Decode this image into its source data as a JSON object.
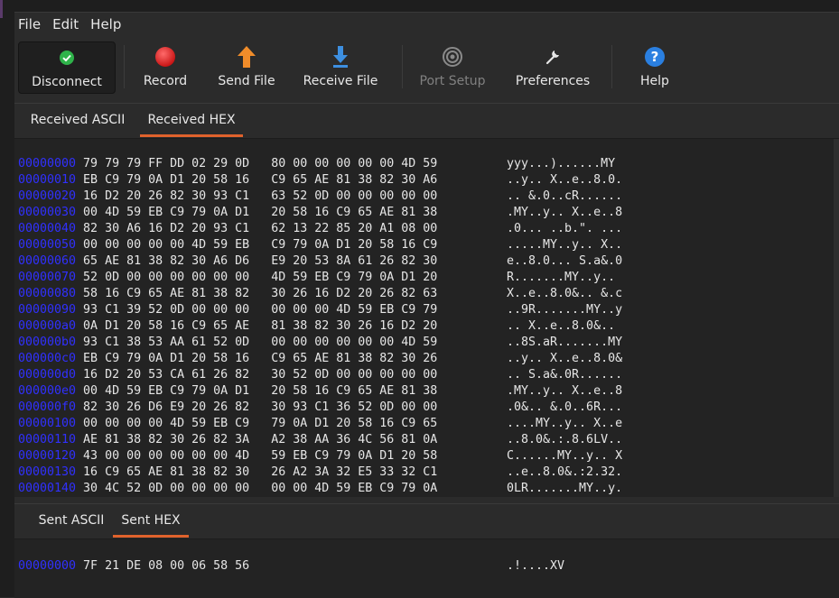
{
  "menu": [
    "File",
    "Edit",
    "Help"
  ],
  "toolbar": {
    "disconnect": "Disconnect",
    "record": "Record",
    "send_file": "Send File",
    "receive_file": "Receive File",
    "port_setup": "Port Setup",
    "preferences": "Preferences",
    "help": "Help"
  },
  "received": {
    "tabs": [
      "Received ASCII",
      "Received HEX"
    ],
    "selected_tab": "Received HEX",
    "rows": [
      {
        "offset": "00000000",
        "hex": "79 79 79 FF DD 02 29 0D   80 00 00 00 00 00 4D 59",
        "ascii": "yyy...)......MY"
      },
      {
        "offset": "00000010",
        "hex": "EB C9 79 0A D1 20 58 16   C9 65 AE 81 38 82 30 A6",
        "ascii": "..y.. X..e..8.0."
      },
      {
        "offset": "00000020",
        "hex": "16 D2 20 26 82 30 93 C1   63 52 0D 00 00 00 00 00",
        "ascii": ".. &.0..cR......"
      },
      {
        "offset": "00000030",
        "hex": "00 4D 59 EB C9 79 0A D1   20 58 16 C9 65 AE 81 38",
        "ascii": ".MY..y.. X..e..8"
      },
      {
        "offset": "00000040",
        "hex": "82 30 A6 16 D2 20 93 C1   62 13 22 85 20 A1 08 00",
        "ascii": ".0... ..b.\". ..."
      },
      {
        "offset": "00000050",
        "hex": "00 00 00 00 00 4D 59 EB   C9 79 0A D1 20 58 16 C9",
        "ascii": ".....MY..y.. X.."
      },
      {
        "offset": "00000060",
        "hex": "65 AE 81 38 82 30 A6 D6   E9 20 53 8A 61 26 82 30",
        "ascii": "e..8.0... S.a&.0"
      },
      {
        "offset": "00000070",
        "hex": "52 0D 00 00 00 00 00 00   4D 59 EB C9 79 0A D1 20",
        "ascii": "R.......MY..y.. "
      },
      {
        "offset": "00000080",
        "hex": "58 16 C9 65 AE 81 38 82   30 26 16 D2 20 26 82 63",
        "ascii": "X..e..8.0&.. &.c"
      },
      {
        "offset": "00000090",
        "hex": "93 C1 39 52 0D 00 00 00   00 00 00 4D 59 EB C9 79",
        "ascii": "..9R.......MY..y"
      },
      {
        "offset": "000000a0",
        "hex": "0A D1 20 58 16 C9 65 AE   81 38 82 30 26 16 D2 20",
        "ascii": ".. X..e..8.0&.. "
      },
      {
        "offset": "000000b0",
        "hex": "93 C1 38 53 AA 61 52 0D   00 00 00 00 00 00 4D 59",
        "ascii": "..8S.aR.......MY"
      },
      {
        "offset": "000000c0",
        "hex": "EB C9 79 0A D1 20 58 16   C9 65 AE 81 38 82 30 26",
        "ascii": "..y.. X..e..8.0&"
      },
      {
        "offset": "000000d0",
        "hex": "16 D2 20 53 CA 61 26 82   30 52 0D 00 00 00 00 00",
        "ascii": ".. S.a&.0R......"
      },
      {
        "offset": "000000e0",
        "hex": "00 4D 59 EB C9 79 0A D1   20 58 16 C9 65 AE 81 38",
        "ascii": ".MY..y.. X..e..8"
      },
      {
        "offset": "000000f0",
        "hex": "82 30 26 D6 E9 20 26 82   30 93 C1 36 52 0D 00 00",
        "ascii": ".0&.. &.0..6R..."
      },
      {
        "offset": "00000100",
        "hex": "00 00 00 00 4D 59 EB C9   79 0A D1 20 58 16 C9 65",
        "ascii": "....MY..y.. X..e"
      },
      {
        "offset": "00000110",
        "hex": "AE 81 38 82 30 26 82 3A   A2 38 AA 36 4C 56 81 0A",
        "ascii": "..8.0&.:.8.6LV.."
      },
      {
        "offset": "00000120",
        "hex": "43 00 00 00 00 00 00 4D   59 EB C9 79 0A D1 20 58",
        "ascii": "C......MY..y.. X"
      },
      {
        "offset": "00000130",
        "hex": "16 C9 65 AE 81 38 82 30   26 A2 3A 32 E5 33 32 C1",
        "ascii": "..e..8.0&.:2.32."
      },
      {
        "offset": "00000140",
        "hex": "30 4C 52 0D 00 00 00 00   00 00 4D 59 EB C9 79 0A",
        "ascii": "0LR.......MY..y."
      }
    ]
  },
  "sent": {
    "tabs": [
      "Sent ASCII",
      "Sent HEX"
    ],
    "selected_tab": "Sent HEX",
    "rows": [
      {
        "offset": "00000000",
        "hex": "7F 21 DE 08 00 06 58 56",
        "ascii": ".!....XV"
      }
    ]
  },
  "colors": {
    "offset_blue": "#3030ff",
    "tab_underline": "#e0622c",
    "connected_green": "#2fb34a",
    "record_red": "#e02828",
    "send_orange": "#f08c2a",
    "receive_blue": "#3d8fe0",
    "help_blue": "#2a7fe0"
  }
}
